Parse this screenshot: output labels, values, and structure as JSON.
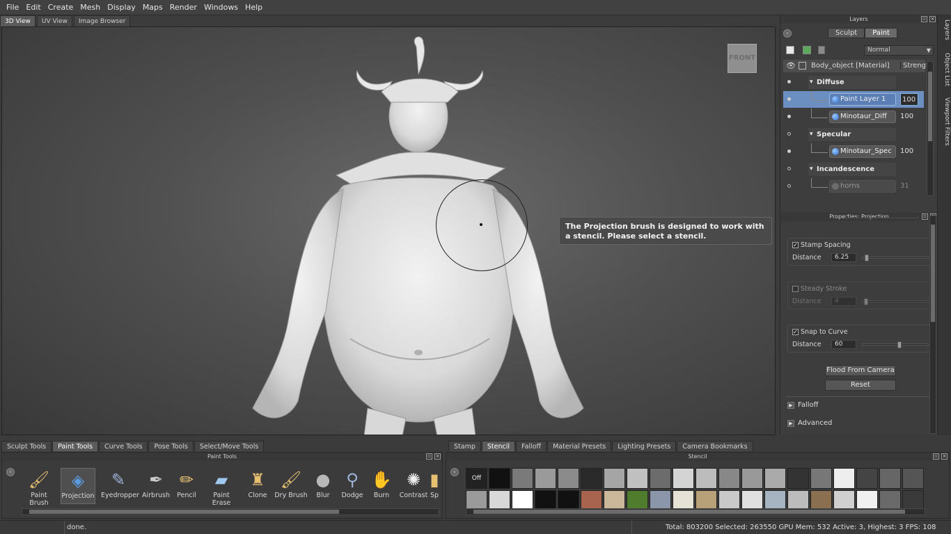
{
  "menu": [
    "File",
    "Edit",
    "Create",
    "Mesh",
    "Display",
    "Maps",
    "Render",
    "Windows",
    "Help"
  ],
  "view_tabs": [
    "3D View",
    "UV View",
    "Image Browser"
  ],
  "viewport": {
    "cube_label": "FRONT",
    "tooltip": "The Projection brush is designed to work with a stencil. Please select a stencil."
  },
  "layers": {
    "title": "Layers",
    "modes": [
      "Sculpt",
      "Paint"
    ],
    "blend_mode": "Normal",
    "object_name": "Body_object [Material]",
    "strength_header": "Strengt",
    "rows": [
      {
        "type": "group",
        "label": "Diffuse",
        "visible": true
      },
      {
        "type": "layer",
        "label": "Paint Layer 1",
        "value": "100",
        "visible": true,
        "selected": true
      },
      {
        "type": "layer",
        "label": "Minotaur_Diff",
        "value": "100",
        "visible": true
      },
      {
        "type": "group",
        "label": "Specular",
        "visible": false
      },
      {
        "type": "layer",
        "label": "Minotaur_Spec",
        "value": "100",
        "visible": true
      },
      {
        "type": "group",
        "label": "Incandescence",
        "visible": false
      },
      {
        "type": "layer",
        "label": "horns",
        "value": "31",
        "visible": false,
        "dim": true
      }
    ]
  },
  "properties": {
    "title": "Properties: Projection",
    "stamp_spacing": {
      "label": "Stamp Spacing",
      "checked": true,
      "distance_label": "Distance",
      "value": "6.25",
      "fraction": 0.03
    },
    "steady_stroke": {
      "label": "Steady Stroke",
      "checked": false,
      "distance_label": "Distance",
      "value": "4",
      "fraction": 0.02
    },
    "snap_to_curve": {
      "label": "Snap to Curve",
      "checked": true,
      "distance_label": "Distance",
      "value": "60",
      "fraction": 0.55
    },
    "flood_button": "Flood From Camera",
    "reset_button": "Reset",
    "falloff": "Falloff",
    "advanced": "Advanced"
  },
  "side_tabs": [
    "Layers",
    "Object List",
    "Viewport Filters"
  ],
  "bottom_left_tabs": [
    "Sculpt Tools",
    "Paint Tools",
    "Curve Tools",
    "Pose Tools",
    "Select/Move Tools"
  ],
  "bottom_left_active": "Paint Tools",
  "paint_tools_title": "Paint Tools",
  "tools": [
    {
      "label": "Paint Brush",
      "icon": "paint-brush-icon"
    },
    {
      "label": "Projection",
      "icon": "projection-icon",
      "active": true
    },
    {
      "label": "Eyedropper",
      "icon": "eyedropper-icon"
    },
    {
      "label": "Airbrush",
      "icon": "airbrush-icon"
    },
    {
      "label": "Pencil",
      "icon": "pencil-icon"
    },
    {
      "label": "Paint Erase",
      "icon": "eraser-icon"
    },
    {
      "label": "Clone",
      "icon": "clone-stamp-icon"
    },
    {
      "label": "Dry Brush",
      "icon": "dry-brush-icon"
    },
    {
      "label": "Blur",
      "icon": "blur-drop-icon"
    },
    {
      "label": "Dodge",
      "icon": "dodge-icon"
    },
    {
      "label": "Burn",
      "icon": "burn-hand-icon"
    },
    {
      "label": "Contrast",
      "icon": "contrast-icon"
    },
    {
      "label": "Sp",
      "icon": "sponge-icon"
    }
  ],
  "bottom_right_tabs": [
    "Stamp",
    "Stencil",
    "Falloff",
    "Material Presets",
    "Lighting Presets",
    "Camera Bookmarks"
  ],
  "bottom_right_active": "Stencil",
  "stencil_title": "Stencil",
  "stencil_off": "Off",
  "status": {
    "left": "done.",
    "right": "Total: 803200  Selected: 263550 GPU Mem: 532  Active: 3, Highest: 3  FPS: 108"
  }
}
